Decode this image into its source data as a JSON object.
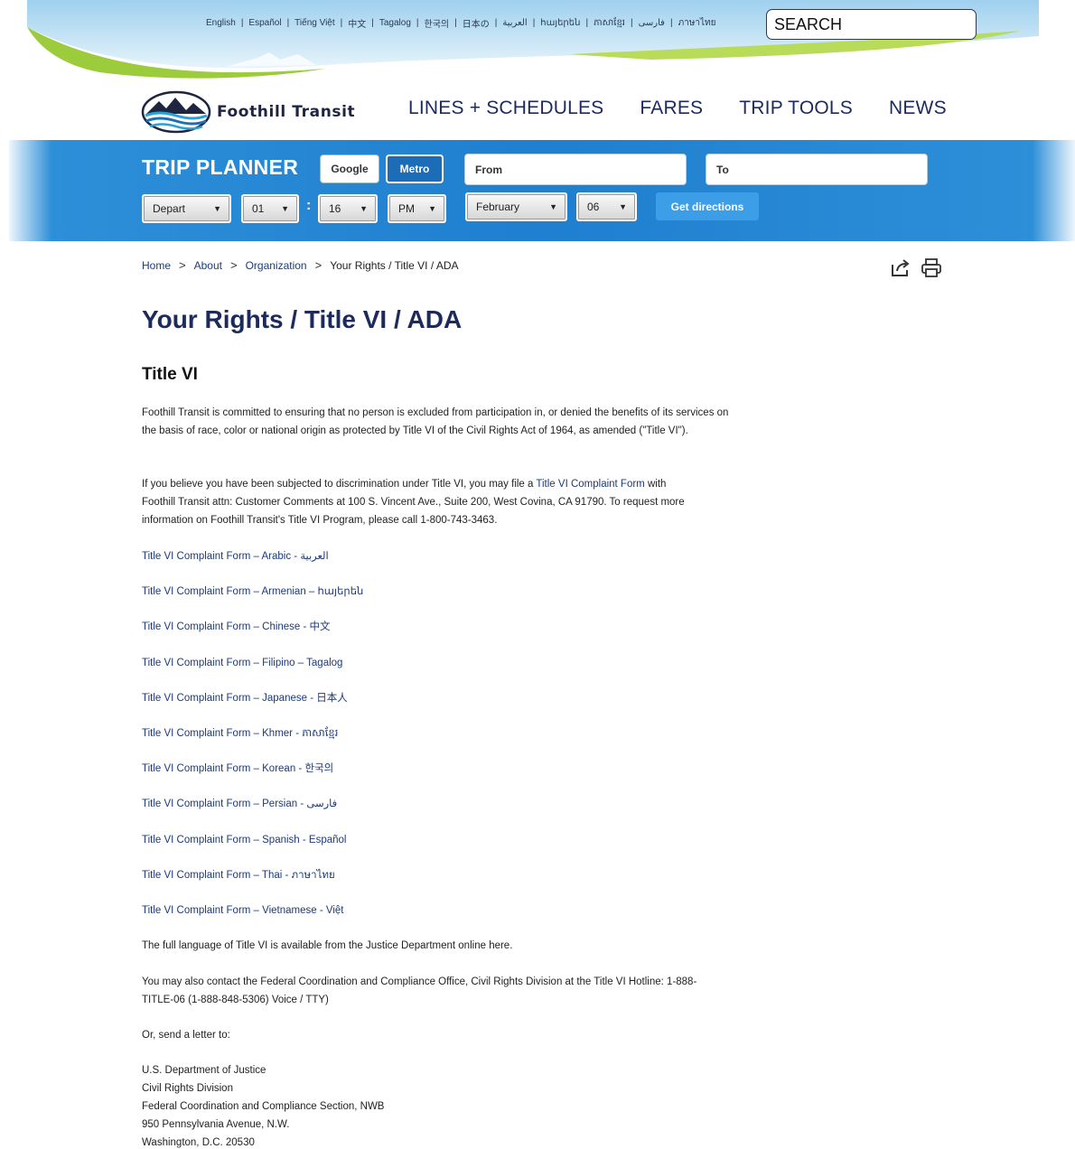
{
  "languages": [
    "English",
    "Español",
    "Tiếng Việt",
    "中文",
    "Tagalog",
    "한국의",
    "日本の",
    "العربية",
    "հայերեն",
    "ភាសាខ្មែរ",
    "فارسی",
    "ภาษาไทย"
  ],
  "search": {
    "placeholder": "SEARCH"
  },
  "brand": {
    "name": "Foothill Transit"
  },
  "nav": [
    "LINES + SCHEDULES",
    "FARES",
    "TRIP TOOLS",
    "NEWS"
  ],
  "trip_planner": {
    "title": "TRIP PLANNER",
    "google_label": "Google",
    "metro_label": "Metro",
    "from_placeholder": "From",
    "to_placeholder": "To",
    "depart": "Depart",
    "hour": "01",
    "minute": "16",
    "ampm": "PM",
    "month": "February",
    "day": "06",
    "get_directions": "Get directions"
  },
  "breadcrumb": {
    "home": "Home",
    "about": "About",
    "organization": "Organization",
    "current": "Your Rights / Title VI / ADA",
    "sep": ">"
  },
  "page_title": "Your Rights / Title VI / ADA",
  "section_heading": "Title VI",
  "intro": "Foothill Transit is committed to ensuring that no person is excluded from participation in, or denied the benefits of its services on the basis of race, color or national origin as protected by Title VI of the Civil Rights Act of 1964, as amended (\"Title VI\").",
  "complaint_para": {
    "before": "If you believe you have been subjected to discrimination under Title VI, you may file a ",
    "link": "Title VI Complaint Form",
    "after": " with Foothill Transit attn: Customer Comments at 100 S. Vincent Ave., Suite 200, West Covina, CA 91790. To request more information on Foothill Transit's Title VI Program, please call 1-800-743-3463."
  },
  "forms": [
    "Title VI Complaint Form – Arabic - العربية",
    "Title VI Complaint Form – Armenian – հայերեն",
    "Title VI Complaint Form – Chinese - 中文",
    "Title VI Complaint Form – Filipino – Tagalog",
    "Title VI Complaint Form – Japanese - 日本人",
    "Title VI Complaint Form – Khmer - ភាសាខ្មែរ",
    "Title VI Complaint Form – Korean - 한국의",
    "Title VI Complaint Form – Persian - فارسی",
    "Title VI Complaint Form – Spanish - Español",
    "Title VI Complaint Form – Thai - ภาษาไทย",
    "Title VI Complaint Form – Vietnamese - Việt"
  ],
  "full_language": {
    "before": "The full language of Title VI is available from the Justice Department online ",
    "link": "here",
    "after": "."
  },
  "contact_para": "You may also contact the Federal Coordination and Compliance Office, Civil Rights Division at the Title VI Hotline: 1-888-TITLE-06 (1-888-848-5306) Voice / TTY)",
  "letter_intro": "Or, send a letter to:",
  "address": [
    "U.S. Department of Justice",
    "Civil Rights Division",
    "Federal Coordination and Compliance Section, NWB",
    "950 Pennsylvania Avenue, N.W.",
    "Washington, D.C. 20530"
  ],
  "colors": {
    "brand_navy": "#1c2a5c",
    "planner_blue": "#1f7fd0",
    "link_blue": "#1d3a7a",
    "banner_green": "#9ccc3c"
  },
  "icons": [
    "share-icon",
    "print-icon",
    "dropdown-arrow-icon",
    "mountain-logo-icon"
  ]
}
